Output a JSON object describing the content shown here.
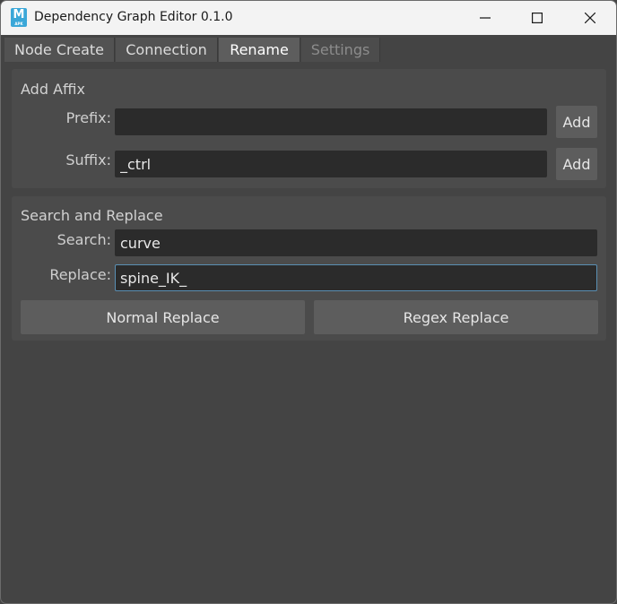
{
  "window": {
    "title": "Dependency Graph Editor 0.1.0",
    "icon_letter": "M",
    "icon_sub": "APK",
    "icon_name": "maya-app-icon"
  },
  "tabs": [
    {
      "label": "Node Create",
      "state": "normal"
    },
    {
      "label": "Connection",
      "state": "normal"
    },
    {
      "label": "Rename",
      "state": "active"
    },
    {
      "label": "Settings",
      "state": "disabled"
    }
  ],
  "add_affix": {
    "title": "Add Affix",
    "prefix_label": "Prefix:",
    "prefix_value": "",
    "prefix_add": "Add",
    "suffix_label": "Suffix:",
    "suffix_value": "_ctrl",
    "suffix_add": "Add"
  },
  "search_replace": {
    "title": "Search and Replace",
    "search_label": "Search:",
    "search_value": "curve",
    "replace_label": "Replace:",
    "replace_value": "spine_IK_",
    "normal_button": "Normal Replace",
    "regex_button": "Regex Replace"
  },
  "colors": {
    "background": "#444444",
    "group": "#4b4b4b",
    "input": "#2b2b2b",
    "button": "#5d5d5d",
    "focus_border": "#5a8fb3",
    "titlebar": "#f3f3f3"
  }
}
